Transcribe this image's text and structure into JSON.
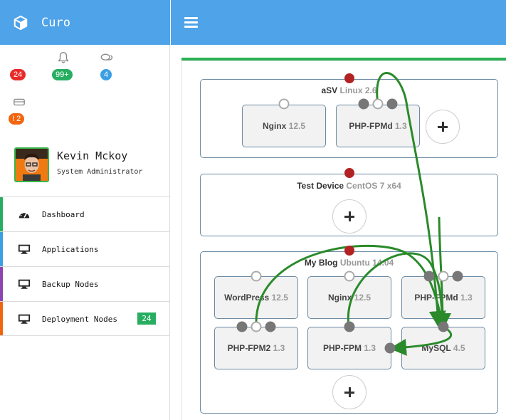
{
  "app": {
    "title": "Curo"
  },
  "status": {
    "alerts_badge": "24",
    "notifications_badge": "99+",
    "messages_badge": "4",
    "storage_badge": "! 2"
  },
  "profile": {
    "name": "Kevin Mckoy",
    "role": "System Administrator"
  },
  "nav": {
    "items": [
      {
        "label": "Dashboard",
        "accent": "#27ae60"
      },
      {
        "label": "Applications",
        "accent": "#3a9fe5"
      },
      {
        "label": "Backup Nodes",
        "accent": "#8e44ad"
      },
      {
        "label": "Deployment Nodes",
        "accent": "#f2650f",
        "count": "24"
      }
    ]
  },
  "devices": [
    {
      "name": "aSV",
      "os": "Linux 2.6",
      "services": [
        {
          "name": "Nginx",
          "version": "12.5"
        },
        {
          "name": "PHP-FPMd",
          "version": "1.3"
        }
      ]
    },
    {
      "name": "Test Device",
      "os": "CentOS 7 x64",
      "services": []
    },
    {
      "name": "My Blog",
      "os": "Ubuntu 14.04",
      "services": [
        {
          "name": "WordPress",
          "version": "12.5"
        },
        {
          "name": "Nginx",
          "version": "12.5"
        },
        {
          "name": "PHP-FPMd",
          "version": "1.3"
        },
        {
          "name": "PHP-FPM2",
          "version": "1.3"
        },
        {
          "name": "PHP-FPM",
          "version": "1.3"
        },
        {
          "name": "MySQL",
          "version": "4.5"
        }
      ]
    }
  ],
  "colors": {
    "header": "#4fa3e8",
    "connection": "#2a8a2a",
    "device_indicator": "#b22222",
    "port": "#777777"
  }
}
